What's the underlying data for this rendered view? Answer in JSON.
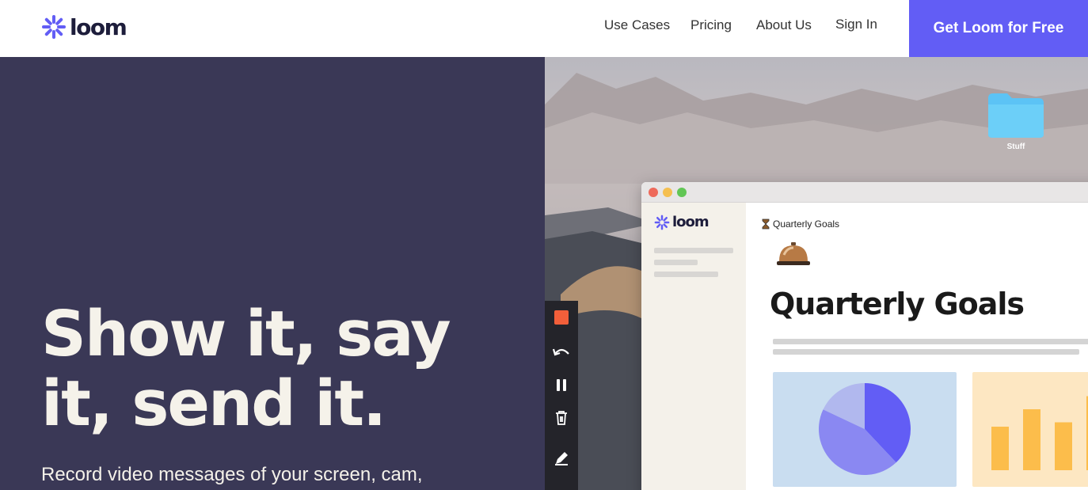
{
  "brand": {
    "logo_text": "loom",
    "accent_color": "#625df5"
  },
  "nav": {
    "links": [
      "Use Cases",
      "Pricing",
      "About Us",
      "Sign In"
    ],
    "cta_label": "Get Loom for Free"
  },
  "hero": {
    "headline": "Show it, say it, send it.",
    "subline": "Record video messages of your screen, cam,",
    "background_color": "#3a3856"
  },
  "desktop": {
    "folder_label": "Stuff",
    "recorder_tools": [
      "stop-icon",
      "undo-icon",
      "pause-icon",
      "trash-icon",
      "pen-icon"
    ]
  },
  "app_window": {
    "sidebar_logo_text": "loom",
    "breadcrumb_icon": "hourglass-icon",
    "breadcrumb": "Quarterly Goals",
    "title": "Quarterly Goals",
    "pie_chart": {
      "slices": [
        0.38,
        0.44,
        0.18
      ],
      "colors": [
        "#625df5",
        "#8a88f2",
        "#b1b8ee"
      ]
    },
    "bar_chart": {
      "values": [
        0.5,
        0.7,
        0.55,
        0.85
      ],
      "color": "#fcbd4b"
    }
  }
}
